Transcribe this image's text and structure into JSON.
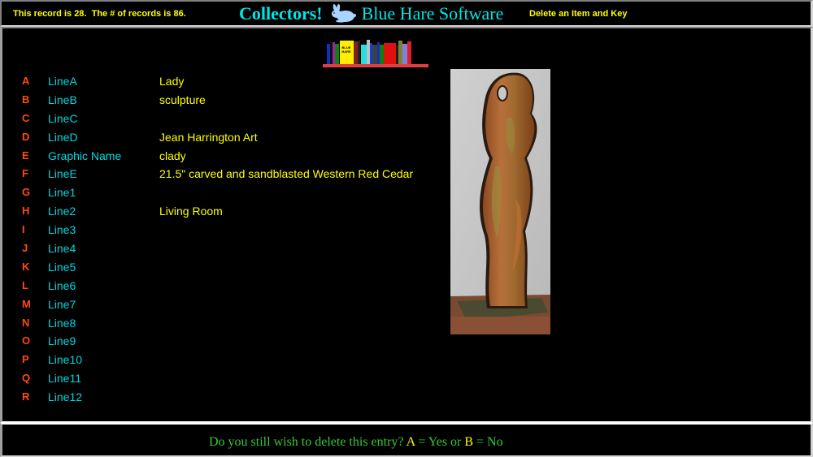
{
  "header": {
    "record_info": "This record is 28.  The # of records is 86.",
    "brand_name": "Collectors!",
    "brand_icon": "rabbit-icon",
    "company_name": "Blue Hare Software",
    "page_action": "Delete an Item and Key"
  },
  "logo": {
    "icon": "bookshelf-logo",
    "book_label": "BLUE HARE"
  },
  "fields": [
    {
      "key": "A",
      "label": "LineA",
      "value": "Lady"
    },
    {
      "key": "B",
      "label": "LineB",
      "value": "sculpture"
    },
    {
      "key": "C",
      "label": "LineC",
      "value": ""
    },
    {
      "key": "D",
      "label": "LineD",
      "value": "Jean Harrington Art"
    },
    {
      "key": "E",
      "label": "Graphic Name",
      "value": "clady"
    },
    {
      "key": "F",
      "label": "LineE",
      "value": "21.5\" carved and sandblasted Western Red Cedar"
    },
    {
      "key": "G",
      "label": "Line1",
      "value": ""
    },
    {
      "key": "H",
      "label": "Line2",
      "value": "Living Room"
    },
    {
      "key": "I",
      "label": "Line3",
      "value": ""
    },
    {
      "key": "J",
      "label": "Line4",
      "value": ""
    },
    {
      "key": "K",
      "label": "Line5",
      "value": ""
    },
    {
      "key": "L",
      "label": "Line6",
      "value": ""
    },
    {
      "key": "M",
      "label": "Line7",
      "value": ""
    },
    {
      "key": "N",
      "label": "Line8",
      "value": ""
    },
    {
      "key": "O",
      "label": "Line9",
      "value": ""
    },
    {
      "key": "P",
      "label": "Line10",
      "value": ""
    },
    {
      "key": "Q",
      "label": "Line11",
      "value": ""
    },
    {
      "key": "R",
      "label": "Line12",
      "value": ""
    }
  ],
  "picture": {
    "description": "sculpture-photo",
    "alt": "clady"
  },
  "prompt": {
    "question": "Do you still wish to delete this entry? ",
    "option_a_key": "A",
    "option_a_text": " = Yes or ",
    "option_b_key": "B",
    "option_b_text": " = No"
  },
  "colors": {
    "background": "#000000",
    "key_color": "#ff4a12",
    "label_color": "#00d8e0",
    "value_color": "#ffff00",
    "brand_color": "#00e6e6",
    "prompt_color": "#33cc33"
  }
}
